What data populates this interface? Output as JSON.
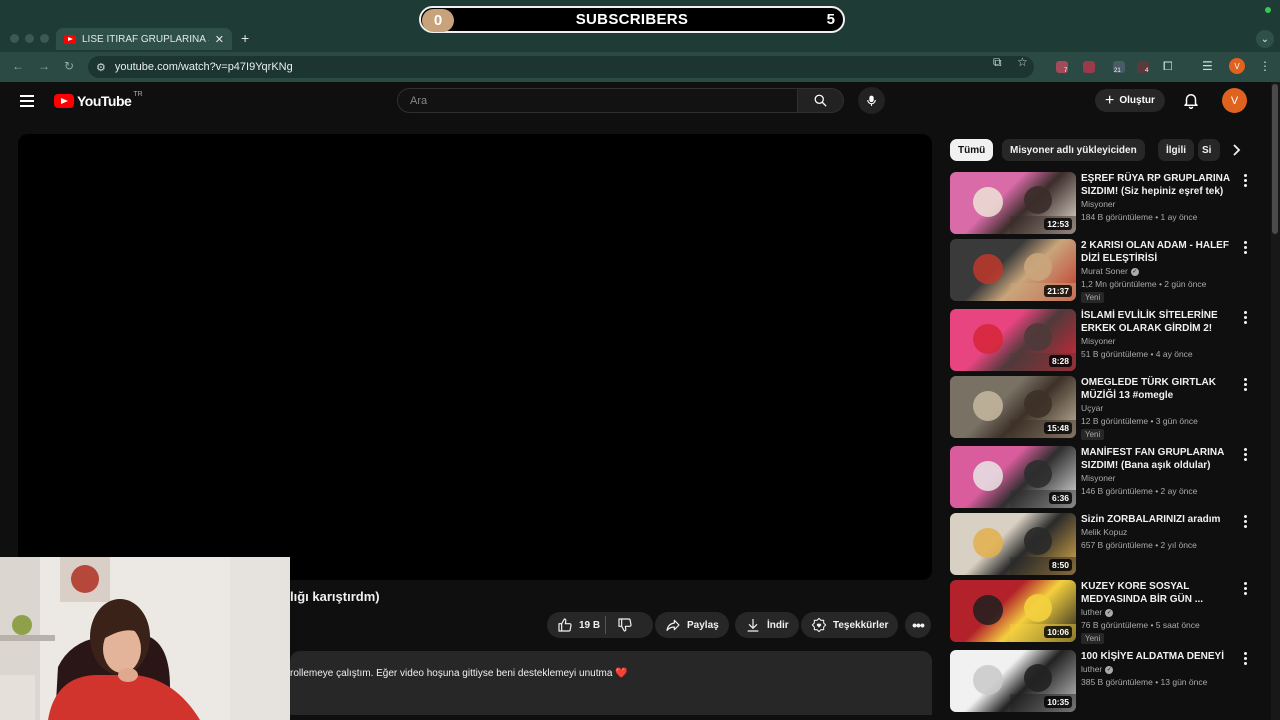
{
  "overlay": {
    "left_count": "0",
    "title": "SUBSCRIBERS",
    "right_count": "5"
  },
  "browser": {
    "tab_title": "LİSE İTİRAF GRUPLARINA SIZ",
    "url": "youtube.com/watch?v=p47I9YqrKNg",
    "extension_badges": [
      "7",
      "21",
      "4"
    ],
    "profile_initial": "V"
  },
  "masthead": {
    "logo_text": "YouTube",
    "region": "TR",
    "search_placeholder": "Ara",
    "create_label": "Oluştur",
    "avatar_initial": "V"
  },
  "video": {
    "title_fragment": "lığı karıştırdm)",
    "like_count": "19 B",
    "share_label": "Paylaş",
    "download_label": "İndir",
    "thanks_label": "Teşekkürler",
    "description_fragment": "rollemeye çalıştım. Eğer video hoşuna gittiyse beni desteklemeyi unutma",
    "description_heart": "❤️"
  },
  "sidebar": {
    "chips": [
      {
        "label": "Tümü",
        "active": true
      },
      {
        "label": "Misyoner adlı yükleyiciden",
        "active": false
      },
      {
        "label": "İlgili",
        "active": false
      },
      {
        "label": "Si",
        "active": false
      }
    ],
    "recommendations": [
      {
        "title": "EŞREF RÜYA RP GRUPLARINA SIZDIM! (Siz hepiniz eşref tek)",
        "channel": "Misyoner",
        "verified": false,
        "meta": "184 B görüntüleme • 1 ay önce",
        "duration": "12:53",
        "new": "",
        "thumb_colors": [
          "#d96ba8",
          "#3b2d2a",
          "#ece3d6"
        ]
      },
      {
        "title": "2 KARISI OLAN ADAM - HALEF DİZİ ELEŞTİRİSİ",
        "channel": "Murat Soner",
        "verified": true,
        "meta": "1,2 Mn görüntüleme • 2 gün önce",
        "duration": "21:37",
        "new": "Yeni",
        "thumb_colors": [
          "#3a3a3a",
          "#c9a57c",
          "#c0382b"
        ]
      },
      {
        "title": "İSLAMİ EVLİLİK SİTELERİNE ERKEK OLARAK GİRDİM 2!",
        "channel": "Misyoner",
        "verified": false,
        "meta": "51 B görüntüleme • 4 ay önce",
        "duration": "8:28",
        "new": "",
        "thumb_colors": [
          "#e8447f",
          "#4f3a3a",
          "#d72638"
        ]
      },
      {
        "title": "OMEGLEDE TÜRK GIRTLAK MÜZİĞİ 13 #omegle",
        "channel": "Uçyar",
        "verified": false,
        "meta": "12 B görüntüleme • 3 gün önce",
        "duration": "15:48",
        "new": "Yeni",
        "thumb_colors": [
          "#7a7165",
          "#3d3128",
          "#c7b9a0"
        ]
      },
      {
        "title": "MANİFEST FAN GRUPLARINA SIZDIM! (Bana aşık oldular)",
        "channel": "Misyoner",
        "verified": false,
        "meta": "146 B görüntüleme • 2 ay önce",
        "duration": "6:36",
        "new": "",
        "thumb_colors": [
          "#d95d9c",
          "#2e2e2e",
          "#e5e5e5"
        ]
      },
      {
        "title": "Sizin ZORBALARINIZI aradım",
        "channel": "Melik Kopuz",
        "verified": false,
        "meta": "657 B görüntüleme • 2 yıl önce",
        "duration": "8:50",
        "new": "",
        "thumb_colors": [
          "#d8d0c2",
          "#2a2a2a",
          "#e3b04b"
        ]
      },
      {
        "title": "KUZEY KORE SOSYAL MEDYASINDA BİR GÜN ...",
        "channel": "luther",
        "verified": true,
        "meta": "76 B görüntüleme • 5 saat önce",
        "duration": "10:06",
        "new": "Yeni",
        "thumb_colors": [
          "#b3222b",
          "#f4d03f",
          "#1f1f1f"
        ]
      },
      {
        "title": "100 KİŞİYE ALDATMA DENEYİ",
        "channel": "luther",
        "verified": true,
        "meta": "385 B görüntüleme • 13 gün önce",
        "duration": "10:35",
        "new": "",
        "thumb_colors": [
          "#f1f1f1",
          "#222222",
          "#c9c9c9"
        ]
      }
    ]
  },
  "colors": {
    "accent_red": "#ff0000",
    "avatar_orange": "#e0621f",
    "chrome_green": "#1f3b36"
  }
}
